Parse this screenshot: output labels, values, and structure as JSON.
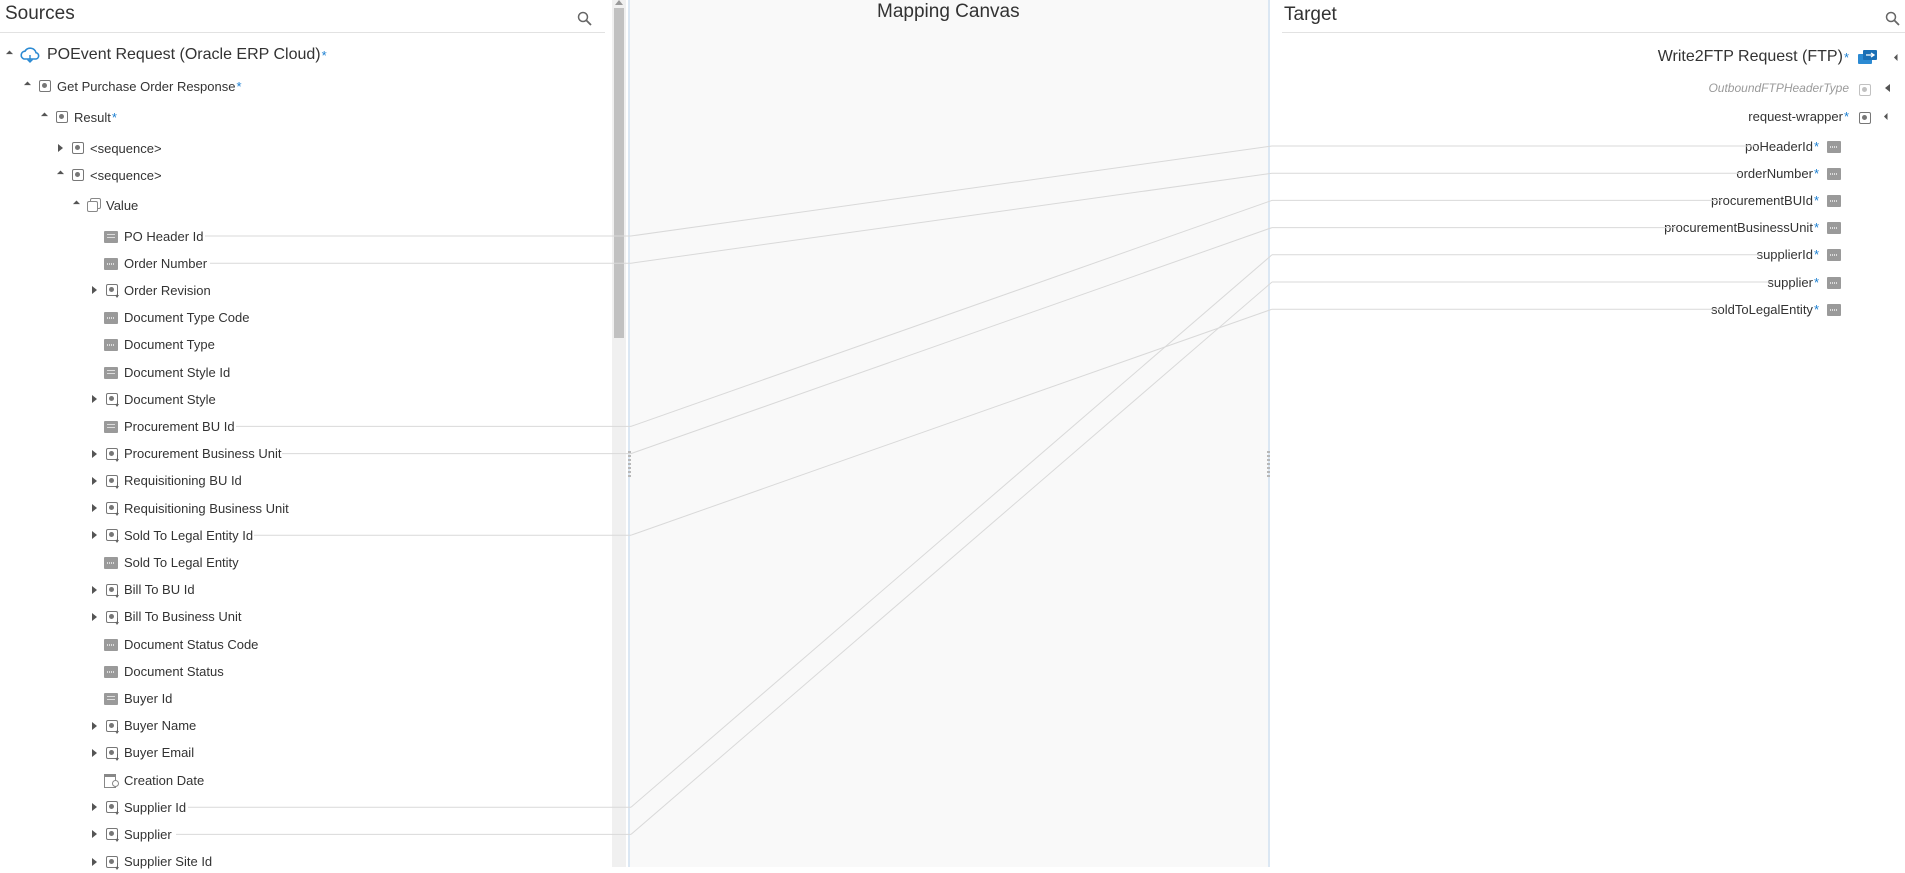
{
  "sources": {
    "title": "Sources",
    "search_icon": "search-icon",
    "root": "POEvent Request (Oracle ERP Cloud)",
    "response": "Get Purchase Order Response",
    "result": "Result",
    "sequence1": "<sequence>",
    "sequence2": "<sequence>",
    "value": "Value",
    "fields": [
      "PO Header Id",
      "Order Number",
      "Order Revision",
      "Document Type Code",
      "Document Type",
      "Document Style Id",
      "Document Style",
      "Procurement BU Id",
      "Procurement Business Unit",
      "Requisitioning BU Id",
      "Requisitioning Business Unit",
      "Sold To Legal Entity Id",
      "Sold To Legal Entity",
      "Bill To BU Id",
      "Bill To Business Unit",
      "Document Status Code",
      "Document Status",
      "Buyer Id",
      "Buyer Name",
      "Buyer Email",
      "Creation Date",
      "Supplier Id",
      "Supplier",
      "Supplier Site Id"
    ],
    "required_marker": "*"
  },
  "canvas": {
    "title": "Mapping Canvas"
  },
  "target": {
    "title": "Target",
    "root": "Write2FTP Request (FTP)",
    "header_type": "OutboundFTPHeaderType",
    "wrapper": "request-wrapper",
    "fields": [
      "poHeaderId",
      "orderNumber",
      "procurementBUId",
      "procurementBusinessUnit",
      "supplierId",
      "supplier",
      "soldToLegalEntity"
    ]
  },
  "colors": {
    "required": "#1a7ed1",
    "canvas_bg": "#f9f9f9",
    "mapping_line": "#d9d9d9",
    "panel_border": "#dbe7f3"
  }
}
